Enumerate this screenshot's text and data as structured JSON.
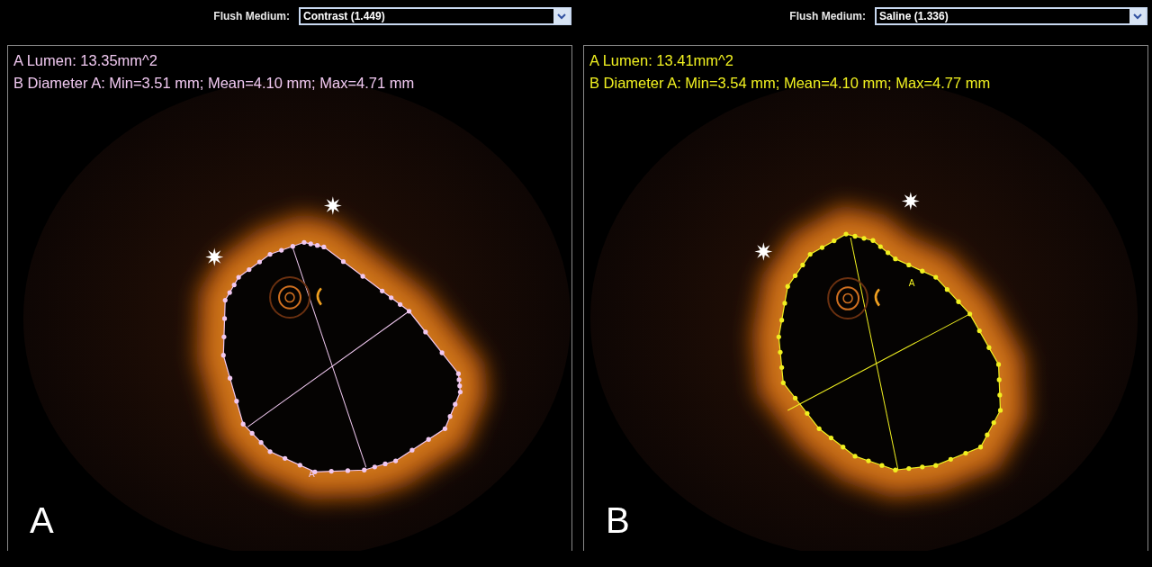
{
  "panels": [
    {
      "letter": "A",
      "flush_label": "Flush Medium:",
      "flush_value": "Contrast (1.449)",
      "color": "#f0c8f0",
      "measurements": [
        "A Lumen: 13.35mm^2",
        "B Diameter A: Min=3.51 mm; Mean=4.10 mm; Max=4.71 mm"
      ],
      "contour_label": "A"
    },
    {
      "letter": "B",
      "flush_label": "Flush Medium:",
      "flush_value": "Saline (1.336)",
      "color": "#f0f020",
      "measurements": [
        "A Lumen: 13.41mm^2",
        "B Diameter A: Min=3.54 mm; Mean=4.10 mm; Max=4.77 mm"
      ],
      "contour_label": "A"
    }
  ]
}
